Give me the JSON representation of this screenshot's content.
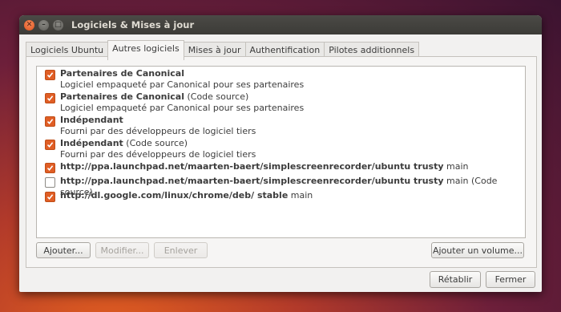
{
  "window": {
    "title": "Logiciels & Mises à jour"
  },
  "tabs": [
    {
      "label": "Logiciels Ubuntu",
      "active": false
    },
    {
      "label": "Autres logiciels",
      "active": true
    },
    {
      "label": "Mises à jour",
      "active": false
    },
    {
      "label": "Authentification",
      "active": false
    },
    {
      "label": "Pilotes additionnels",
      "active": false
    }
  ],
  "sources": [
    {
      "title": "Partenaires de Canonical",
      "suffix": "",
      "desc": "Logiciel empaqueté par Canonical pour ses partenaires",
      "checked": true
    },
    {
      "title": "Partenaires de Canonical",
      "suffix": " (Code source)",
      "desc": "Logiciel empaqueté par Canonical pour ses partenaires",
      "checked": true
    },
    {
      "title": "Indépendant",
      "suffix": "",
      "desc": "Fourni par des développeurs de logiciel tiers",
      "checked": true
    },
    {
      "title": "Indépendant",
      "suffix": " (Code source)",
      "desc": "Fourni par des développeurs de logiciel tiers",
      "checked": true
    },
    {
      "title": "http://ppa.launchpad.net/maarten-baert/simplescreenrecorder/ubuntu trusty",
      "suffix": " main",
      "desc": "",
      "checked": true
    },
    {
      "title": "http://ppa.launchpad.net/maarten-baert/simplescreenrecorder/ubuntu trusty",
      "suffix": " main (Code source)",
      "desc": "",
      "checked": false
    },
    {
      "title": "http://dl.google.com/linux/chrome/deb/ stable",
      "suffix": " main",
      "desc": "",
      "checked": true
    }
  ],
  "buttons": {
    "add": "Ajouter...",
    "edit": "Modifier...",
    "remove": "Enlever",
    "add_volume": "Ajouter un volume...",
    "revert": "Rétablir",
    "close": "Fermer"
  },
  "colors": {
    "checkbox_accent": "#e05e25",
    "titlebar": "#3c3b37"
  }
}
